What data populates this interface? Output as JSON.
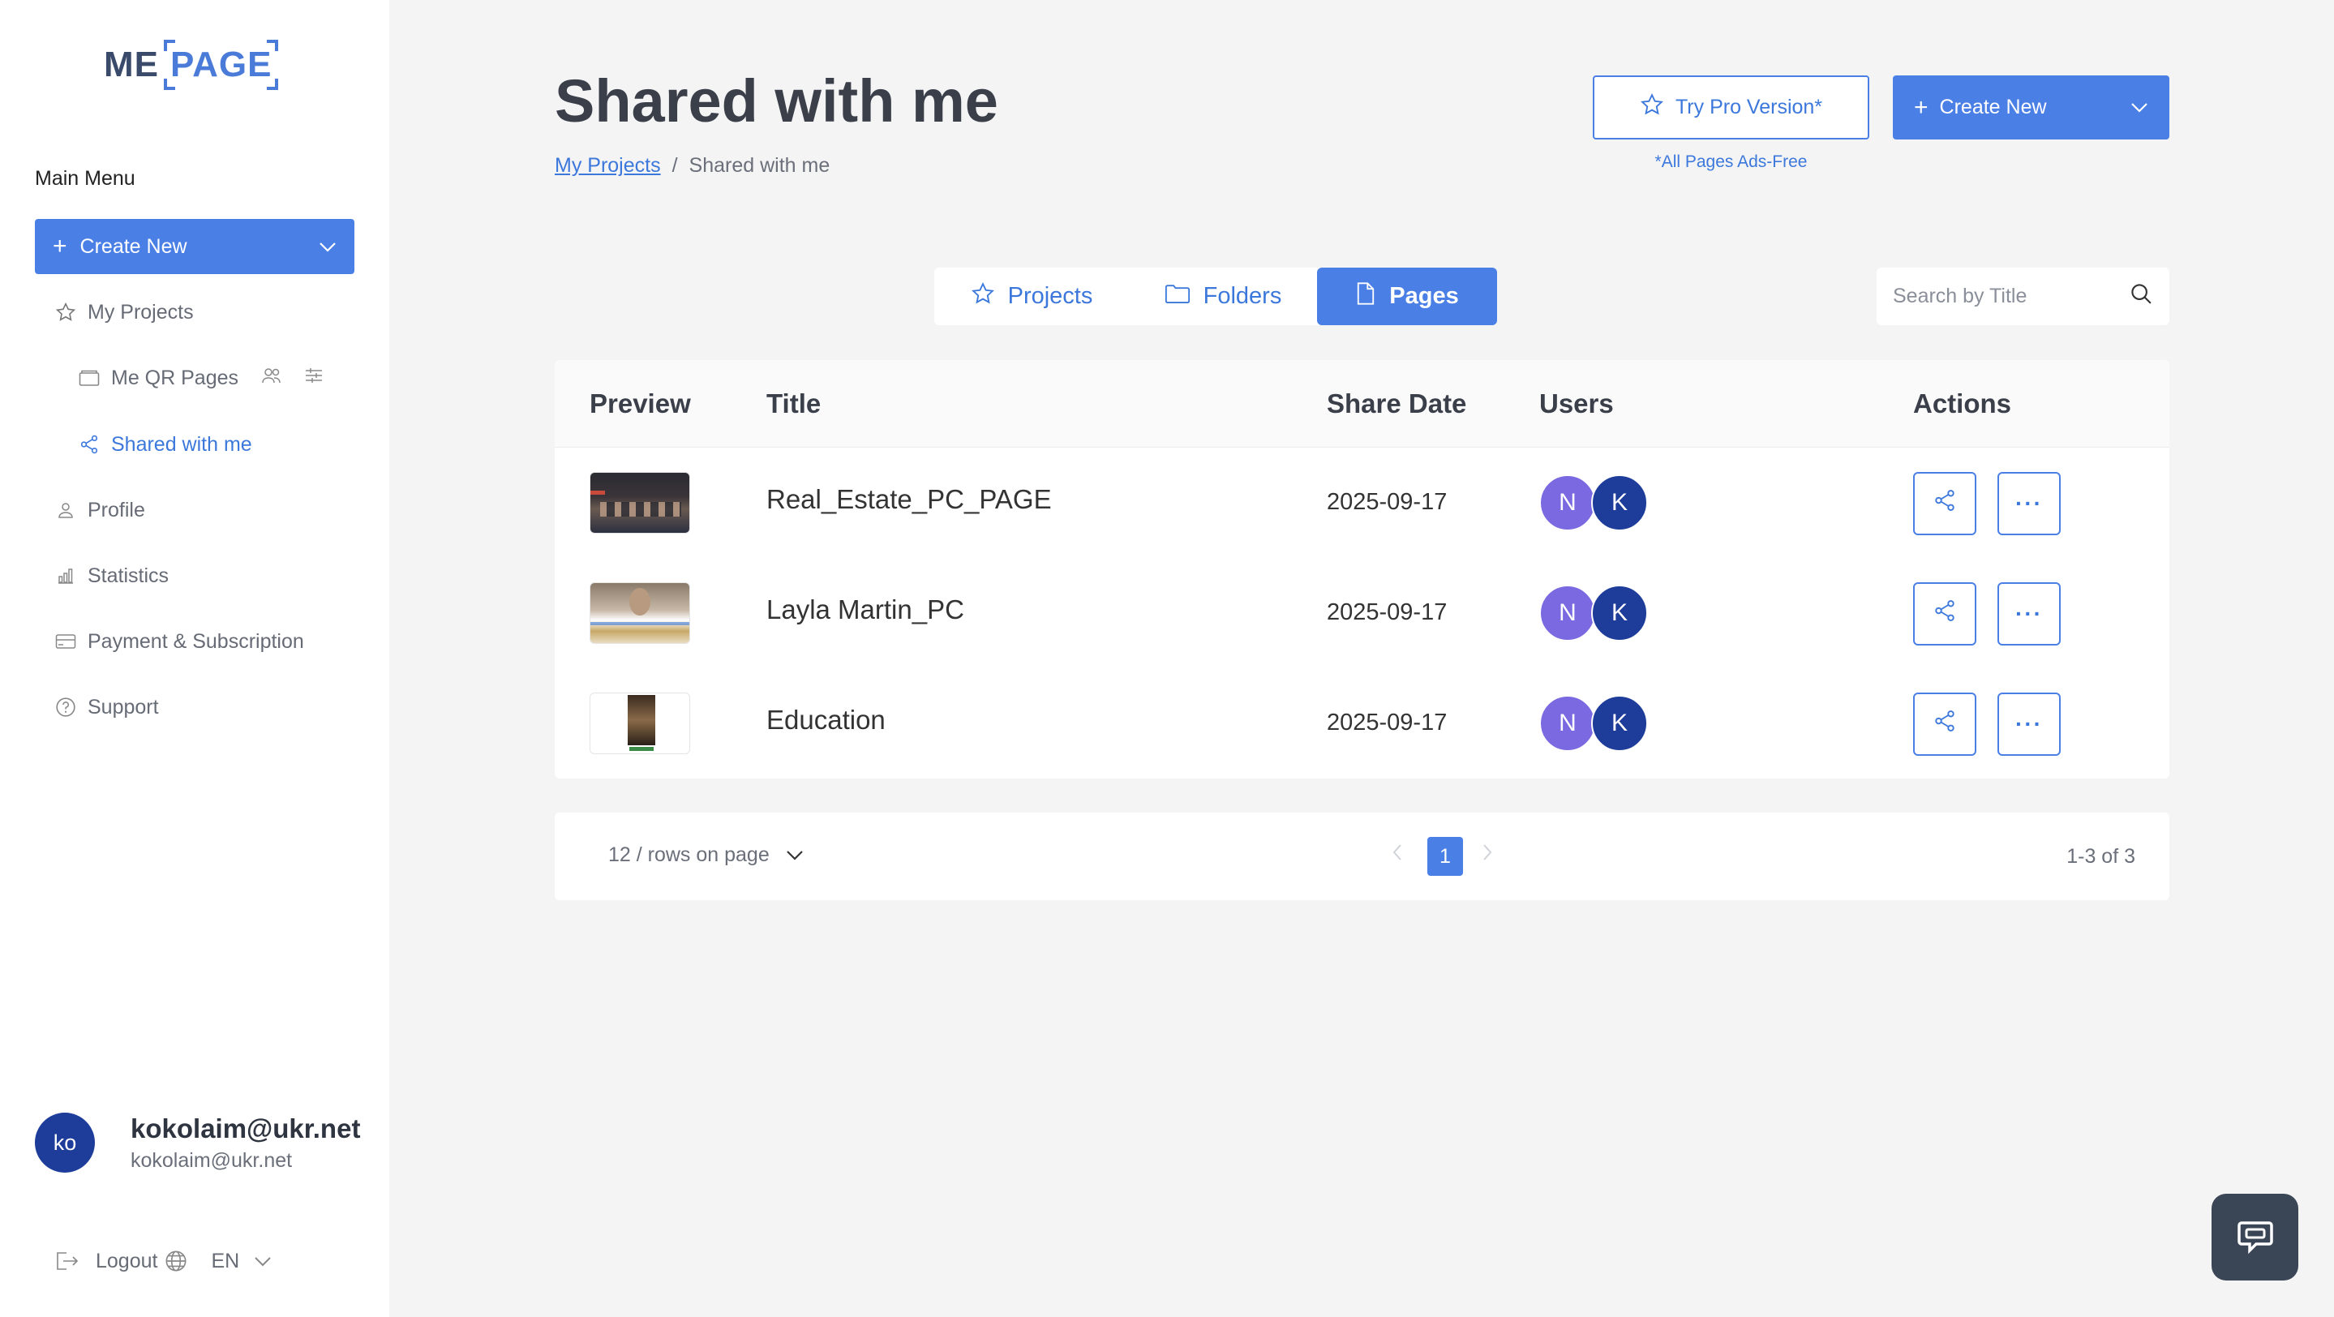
{
  "app": {
    "logo_me": "ME",
    "logo_page": "PAGE"
  },
  "sidebar": {
    "menu_title": "Main Menu",
    "create_label": "Create New",
    "items": [
      {
        "label": "My Projects",
        "icon": "star-icon"
      },
      {
        "label": "Me QR Pages",
        "icon": "folder-icon"
      },
      {
        "label": "Shared with me",
        "icon": "share-icon",
        "active": true
      },
      {
        "label": "Profile",
        "icon": "user-icon"
      },
      {
        "label": "Statistics",
        "icon": "bar-chart-icon"
      },
      {
        "label": "Payment & Subscription",
        "icon": "credit-card-icon"
      },
      {
        "label": "Support",
        "icon": "help-circle-icon"
      }
    ],
    "user": {
      "initials": "ko",
      "name": "kokolaim@ukr.net",
      "email": "kokolaim@ukr.net"
    },
    "logout_label": "Logout",
    "language": "EN"
  },
  "header": {
    "title": "Shared with me",
    "breadcrumb": [
      "My Projects",
      "/",
      "Shared with me"
    ],
    "pro_button": "Try Pro Version*",
    "pro_note": "*All Pages Ads-Free",
    "create_button": "Create New"
  },
  "tabs": [
    {
      "label": "Projects",
      "icon": "star-icon"
    },
    {
      "label": "Folders",
      "icon": "folder-icon"
    },
    {
      "label": "Pages",
      "icon": "file-icon",
      "active": true
    }
  ],
  "search": {
    "placeholder": "Search by Title"
  },
  "table": {
    "columns": [
      "Preview",
      "Title",
      "Share Date",
      "Users",
      "Actions"
    ],
    "rows": [
      {
        "title": "Real_Estate_PC_PAGE",
        "date": "2025-09-17",
        "users": [
          "N",
          "K"
        ]
      },
      {
        "title": "Layla Martin_PC",
        "date": "2025-09-17",
        "users": [
          "N",
          "K"
        ]
      },
      {
        "title": "Education",
        "date": "2025-09-17",
        "users": [
          "N",
          "K"
        ]
      }
    ],
    "more_label": "···"
  },
  "pagination": {
    "rows_per_page": "12 / rows on page",
    "current_page": "1",
    "range": "1-3 of 3"
  },
  "colors": {
    "accent": "#4a7fe6",
    "avatar_n": "#7a69e0",
    "avatar_k": "#1e3d9a",
    "chat": "#3a4556"
  }
}
